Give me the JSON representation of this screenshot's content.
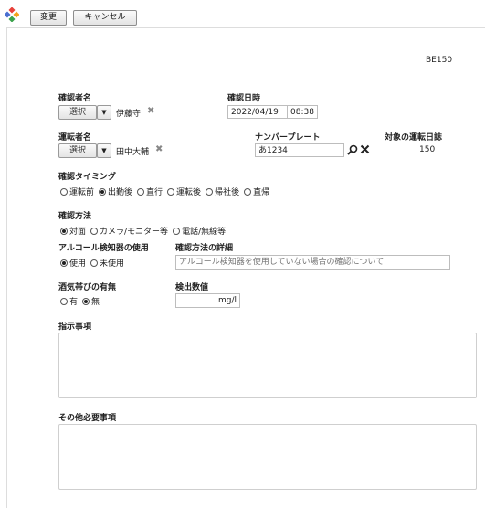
{
  "toolbar": {
    "change_label": "変更",
    "cancel_label": "キャンセル"
  },
  "record_id": "BE150",
  "confirmer": {
    "label": "確認者名",
    "select_label": "選択",
    "value": "伊藤守"
  },
  "confirm_datetime": {
    "label": "確認日時",
    "date": "2022/04/19",
    "time": "08:38"
  },
  "driver": {
    "label": "運転者名",
    "select_label": "選択",
    "value": "田中大輔"
  },
  "number_plate": {
    "label": "ナンバープレート",
    "value": "あ1234"
  },
  "target_log": {
    "label": "対象の運転日誌",
    "value": "150"
  },
  "timing": {
    "label": "確認タイミング",
    "options": [
      "運転前",
      "出勤後",
      "直行",
      "運転後",
      "帰社後",
      "直帰"
    ],
    "selected": "出勤後"
  },
  "method": {
    "label": "確認方法",
    "options": [
      "対面",
      "カメラ/モニター等",
      "電話/無線等"
    ],
    "selected": "対面"
  },
  "detector_use": {
    "label": "アルコール検知器の使用",
    "options": [
      "使用",
      "未使用"
    ],
    "selected": "使用"
  },
  "method_detail": {
    "label": "確認方法の詳細",
    "placeholder": "アルコール検知器を使用していない場合の確認について"
  },
  "drunk": {
    "label": "酒気帯びの有無",
    "options": [
      "有",
      "無"
    ],
    "selected": "無"
  },
  "detected_value": {
    "label": "検出数値",
    "unit": "mg/l"
  },
  "instructions": {
    "label": "指示事項"
  },
  "other_notes": {
    "label": "その他必要事項"
  },
  "icons": {
    "logo": "app-logo-icon",
    "search": "search-icon",
    "close": "close-icon"
  }
}
